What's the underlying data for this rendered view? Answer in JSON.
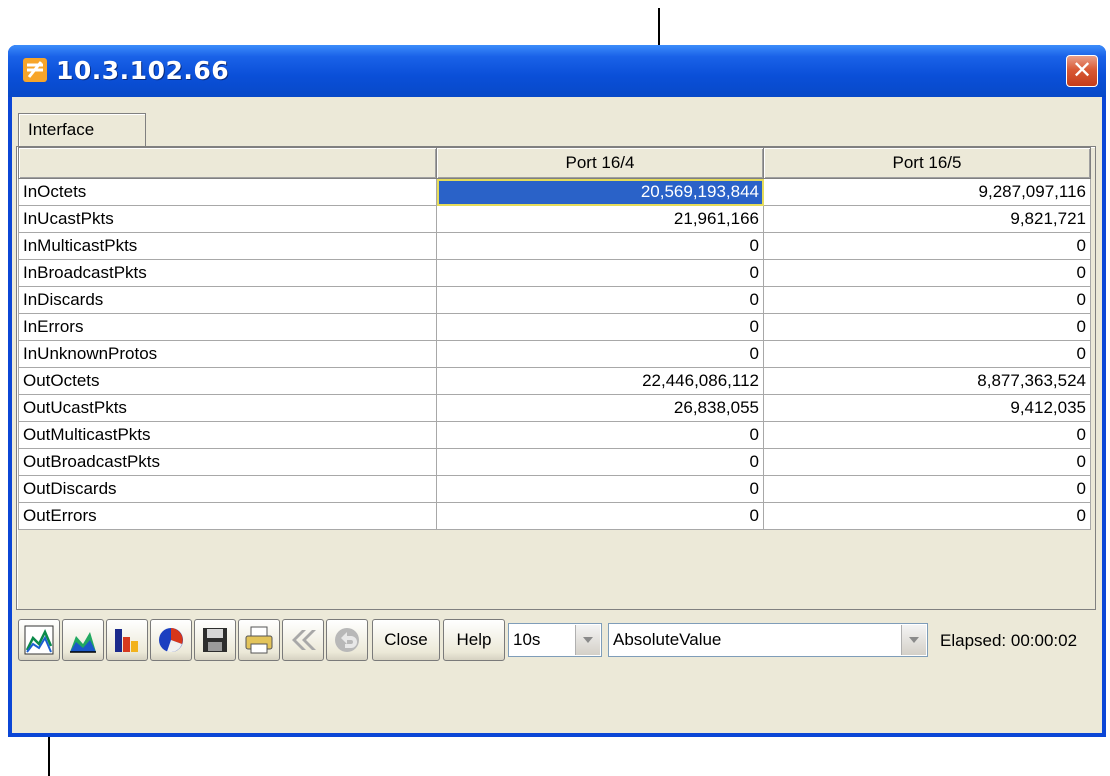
{
  "window": {
    "title": "10.3.102.66",
    "close_symbol": "✕"
  },
  "tabs": [
    {
      "label": "Interface"
    }
  ],
  "table": {
    "columns": [
      "",
      "Port 16/4",
      "Port 16/5"
    ],
    "selected_cell": {
      "row": 0,
      "column": 1
    },
    "rows": [
      {
        "metric": "InOctets",
        "values": [
          "20,569,193,844",
          "9,287,097,116"
        ]
      },
      {
        "metric": "InUcastPkts",
        "values": [
          "21,961,166",
          "9,821,721"
        ]
      },
      {
        "metric": "InMulticastPkts",
        "values": [
          "0",
          "0"
        ]
      },
      {
        "metric": "InBroadcastPkts",
        "values": [
          "0",
          "0"
        ]
      },
      {
        "metric": "InDiscards",
        "values": [
          "0",
          "0"
        ]
      },
      {
        "metric": "InErrors",
        "values": [
          "0",
          "0"
        ]
      },
      {
        "metric": "InUnknownProtos",
        "values": [
          "0",
          "0"
        ]
      },
      {
        "metric": "OutOctets",
        "values": [
          "22,446,086,112",
          "8,877,363,524"
        ]
      },
      {
        "metric": "OutUcastPkts",
        "values": [
          "26,838,055",
          "9,412,035"
        ]
      },
      {
        "metric": "OutMulticastPkts",
        "values": [
          "0",
          "0"
        ]
      },
      {
        "metric": "OutBroadcastPkts",
        "values": [
          "0",
          "0"
        ]
      },
      {
        "metric": "OutDiscards",
        "values": [
          "0",
          "0"
        ]
      },
      {
        "metric": "OutErrors",
        "values": [
          "0",
          "0"
        ]
      }
    ]
  },
  "toolbar": {
    "icon_buttons": [
      {
        "icon": "line-chart-icon"
      },
      {
        "icon": "area-chart-icon"
      },
      {
        "icon": "bar-chart-icon"
      },
      {
        "icon": "pie-chart-icon"
      },
      {
        "icon": "save-icon"
      },
      {
        "icon": "print-icon"
      },
      {
        "icon": "back-arrows-icon"
      },
      {
        "icon": "undo-icon"
      }
    ],
    "close_label": "Close",
    "help_label": "Help",
    "poll_interval": "10s",
    "value_mode": "AbsoluteValue",
    "elapsed": "Elapsed: 00:00:02"
  },
  "colors": {
    "title_bar": "#0b46d6",
    "selection": "#2a62c8",
    "dialog_bg": "#ece9d8"
  }
}
